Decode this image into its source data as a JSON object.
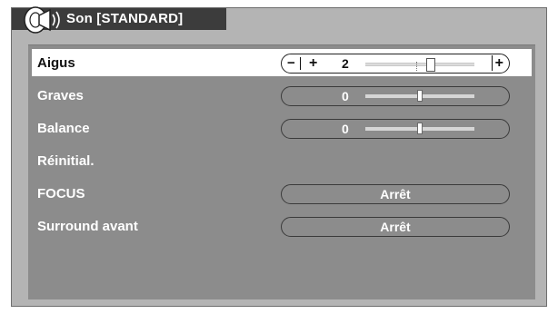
{
  "window": {
    "title": "Son [STANDARD]",
    "icon": "speaker-icon"
  },
  "menu": {
    "items": [
      {
        "label": "Aigus",
        "selected": true,
        "control": "slider",
        "value": "2",
        "level": 2
      },
      {
        "label": "Graves",
        "selected": false,
        "control": "slider",
        "value": "0",
        "level": 0
      },
      {
        "label": "Balance",
        "selected": false,
        "control": "slider",
        "value": "0",
        "level": 0
      },
      {
        "label": "Réinitial.",
        "selected": false,
        "control": "none"
      },
      {
        "label": "FOCUS",
        "selected": false,
        "control": "option",
        "value": "Arrêt"
      },
      {
        "label": "Surround avant",
        "selected": false,
        "control": "option",
        "value": "Arrêt"
      }
    ],
    "slider_buttons": {
      "minus": "−",
      "plus": "+"
    }
  },
  "colors": {
    "frame": "#b4b4b4",
    "panel": "#8c8c8c",
    "title_bar": "#3c3c3c",
    "highlight": "#ffffff"
  }
}
